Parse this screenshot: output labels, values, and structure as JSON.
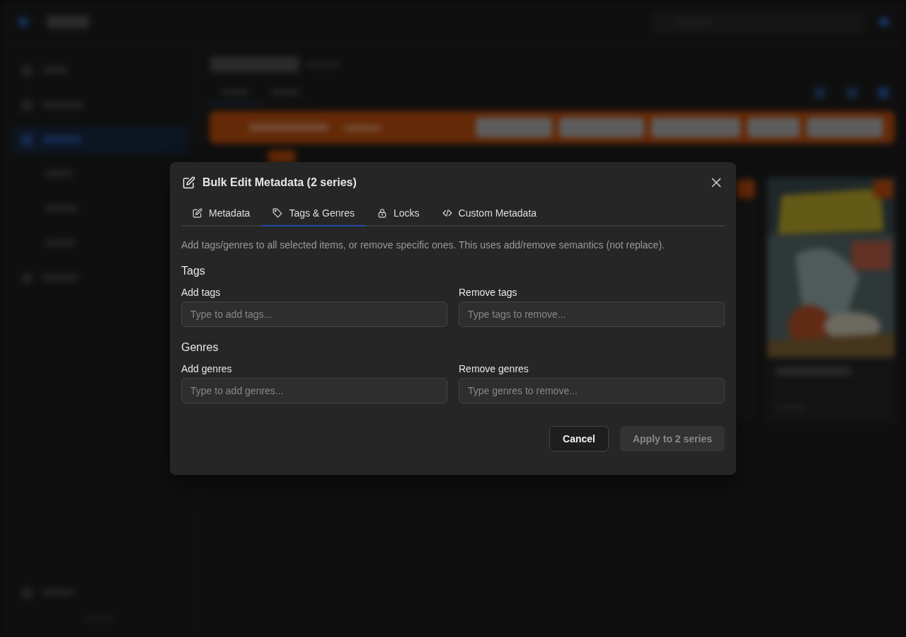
{
  "dialog": {
    "title": "Bulk Edit Metadata (2 series)",
    "tabs": [
      {
        "label": "Metadata",
        "kind": "pencil",
        "selected": false
      },
      {
        "label": "Tags & Genres",
        "kind": "tag",
        "selected": true
      },
      {
        "label": "Locks",
        "kind": "lock",
        "selected": false
      },
      {
        "label": "Custom Metadata",
        "kind": "code",
        "selected": false
      }
    ],
    "description": "Add tags/genres to all selected items, or remove specific ones. This uses add/remove semantics (not replace).",
    "sections": [
      {
        "title": "Tags",
        "fields": [
          {
            "label": "Add tags",
            "placeholder": "Type to add tags..."
          },
          {
            "label": "Remove tags",
            "placeholder": "Type tags to remove..."
          }
        ]
      },
      {
        "title": "Genres",
        "fields": [
          {
            "label": "Add genres",
            "placeholder": "Type to add genres..."
          },
          {
            "label": "Remove genres",
            "placeholder": "Type genres to remove..."
          }
        ]
      }
    ],
    "cancel": "Cancel",
    "apply": {
      "label": "Apply to 2 series",
      "disabled": true
    }
  }
}
